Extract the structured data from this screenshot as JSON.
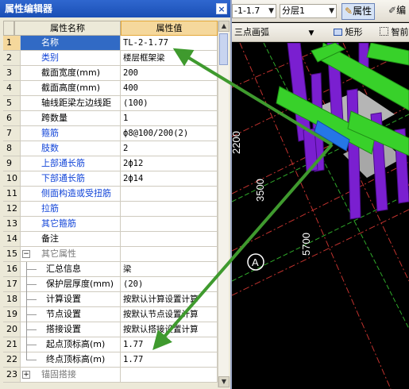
{
  "toolbar": {
    "axis_combo": "-1-1.7",
    "floor_combo": "分层1",
    "properties_button": "属性",
    "edit_button": "编",
    "arc_mode_combo": "三点画弧",
    "rect_button": "矩形",
    "smart_button": "智前"
  },
  "viewport": {
    "dim_label_1": "3500",
    "dim_label_2": "5700",
    "dim_label_3": "2200",
    "axis_bubble": "A"
  },
  "panel": {
    "title": "属性编辑器",
    "close_glyph": "×",
    "header_name": "属性名称",
    "header_value": "属性值"
  },
  "rows": [
    {
      "num": "1",
      "name": "名称",
      "value": "TL-2-1.77",
      "style": "blue"
    },
    {
      "num": "2",
      "name": "类别",
      "value": "楼层框架梁",
      "style": "blue"
    },
    {
      "num": "3",
      "name": "截面宽度(mm)",
      "value": "200",
      "style": "normal"
    },
    {
      "num": "4",
      "name": "截面高度(mm)",
      "value": "400",
      "style": "normal"
    },
    {
      "num": "5",
      "name": "轴线距梁左边线距",
      "value": "(100)",
      "style": "normal"
    },
    {
      "num": "6",
      "name": "跨数量",
      "value": "1",
      "style": "normal"
    },
    {
      "num": "7",
      "name": "箍筋",
      "value": "ф8@100/200(2)",
      "style": "blue"
    },
    {
      "num": "8",
      "name": "肢数",
      "value": "2",
      "style": "blue"
    },
    {
      "num": "9",
      "name": "上部通长筋",
      "value": "2ф12",
      "style": "blue"
    },
    {
      "num": "10",
      "name": "下部通长筋",
      "value": "2ф14",
      "style": "blue"
    },
    {
      "num": "11",
      "name": "侧面构造或受扭筋",
      "value": "",
      "style": "blue"
    },
    {
      "num": "12",
      "name": "拉筋",
      "value": "",
      "style": "blue"
    },
    {
      "num": "13",
      "name": "其它箍筋",
      "value": "",
      "style": "blue"
    },
    {
      "num": "14",
      "name": "备注",
      "value": "",
      "style": "normal"
    },
    {
      "num": "15",
      "name": "其它属性",
      "value": "",
      "style": "gray"
    },
    {
      "num": "16",
      "name": "汇总信息",
      "value": "梁",
      "style": "normal"
    },
    {
      "num": "17",
      "name": "保护层厚度(mm)",
      "value": "(20)",
      "style": "normal"
    },
    {
      "num": "18",
      "name": "计算设置",
      "value": "按默认计算设置计算",
      "style": "normal"
    },
    {
      "num": "19",
      "name": "节点设置",
      "value": "按默认节点设置计算",
      "style": "normal"
    },
    {
      "num": "20",
      "name": "搭接设置",
      "value": "按默认搭接设置计算",
      "style": "normal"
    },
    {
      "num": "21",
      "name": "起点顶标高(m)",
      "value": "1.77",
      "style": "normal"
    },
    {
      "num": "22",
      "name": "终点顶标高(m)",
      "value": "1.77",
      "style": "normal"
    },
    {
      "num": "23",
      "name": "锚固搭接",
      "value": "",
      "style": "gray"
    }
  ],
  "colors": {
    "annotation_arrow": "#3f9a2e",
    "beam_green": "#38d12a",
    "column_purple": "#7a1fd0",
    "selection_blue": "#316ac5"
  }
}
